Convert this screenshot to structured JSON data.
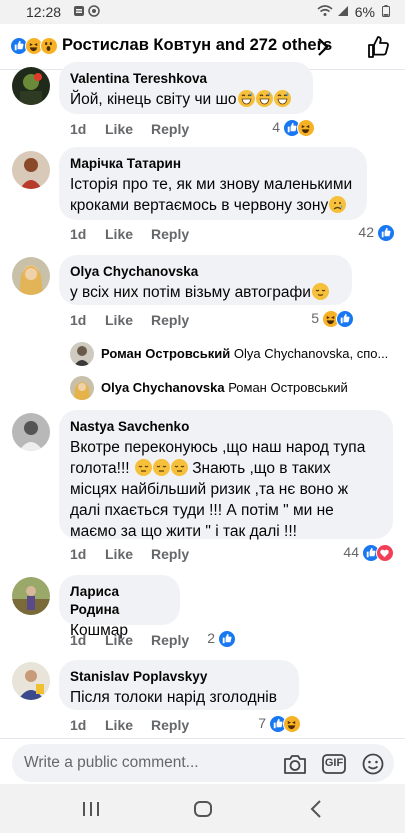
{
  "status_bar": {
    "time": "12:28",
    "battery": "6%"
  },
  "header": {
    "title": "Ростислав Ковтун and 272 others",
    "reactions": [
      "like",
      "haha",
      "wow"
    ]
  },
  "comments": [
    {
      "name": "Valentina Tereshkova",
      "text": "Йой, кінець світу чи шо",
      "emojis": [
        "grinning-sweat-emoji",
        "grinning-sweat-emoji",
        "grinning-sweat-emoji"
      ],
      "time": "1d",
      "like": "Like",
      "reply": "Reply",
      "reaction_count": "4",
      "reactions": [
        "like",
        "haha"
      ]
    },
    {
      "name": "Марічка Татарин",
      "text": "Історія про те, як ми знову маленькими кроками вертаємось в червону зону",
      "emojis": [
        "sad-emoji"
      ],
      "time": "1d",
      "like": "Like",
      "reply": "Reply",
      "reaction_count": "42",
      "reactions": [
        "like"
      ]
    },
    {
      "name": "Olya Chychanovska",
      "text": "у всіх них потім візьму автографи",
      "emojis": [
        "relieved-emoji"
      ],
      "time": "1d",
      "like": "Like",
      "reply": "Reply",
      "reaction_count": "5",
      "reactions": [
        "haha",
        "like"
      ]
    },
    {
      "name": "Nastya Savchenko",
      "text": "Вкотре переконуюсь ,що наш народ тупа голота!!!",
      "text2": "Знають ,що в таких місцях найбільший ризик ,та нє воно ж далі пхається туди !!! А потім \" ми не маємо за що жити \" і так далі !!!",
      "emojis": [
        "pensive-emoji",
        "pensive-emoji",
        "pensive-emoji"
      ],
      "time": "1d",
      "like": "Like",
      "reply": "Reply",
      "reaction_count": "44",
      "reactions": [
        "like",
        "love"
      ]
    },
    {
      "name": "Лариса Родина",
      "text": "Кошмар",
      "emojis": [],
      "time": "1d",
      "like": "Like",
      "reply": "Reply",
      "reaction_count": "2",
      "reactions": [
        "like"
      ]
    },
    {
      "name": "Stanislav Poplavskyy",
      "text": "Після толоки нарід зголоднів",
      "emojis": [],
      "time": "1d",
      "like": "Like",
      "reply": "Reply",
      "reaction_count": "7",
      "reactions": [
        "like",
        "haha"
      ]
    }
  ],
  "replies": [
    {
      "name": "Роман Островський",
      "preview": "Olya Chychanovska, спо..."
    },
    {
      "name": "Olya Chychanovska",
      "preview": "Роман Островський"
    }
  ],
  "composer": {
    "placeholder": "Write a public comment...",
    "gif_label": "GIF"
  },
  "colors": {
    "accent": "#1877f2",
    "bubble": "#f0f2f5",
    "meta": "#65676b",
    "love": "#f33e58",
    "haha": "#f7b125"
  }
}
